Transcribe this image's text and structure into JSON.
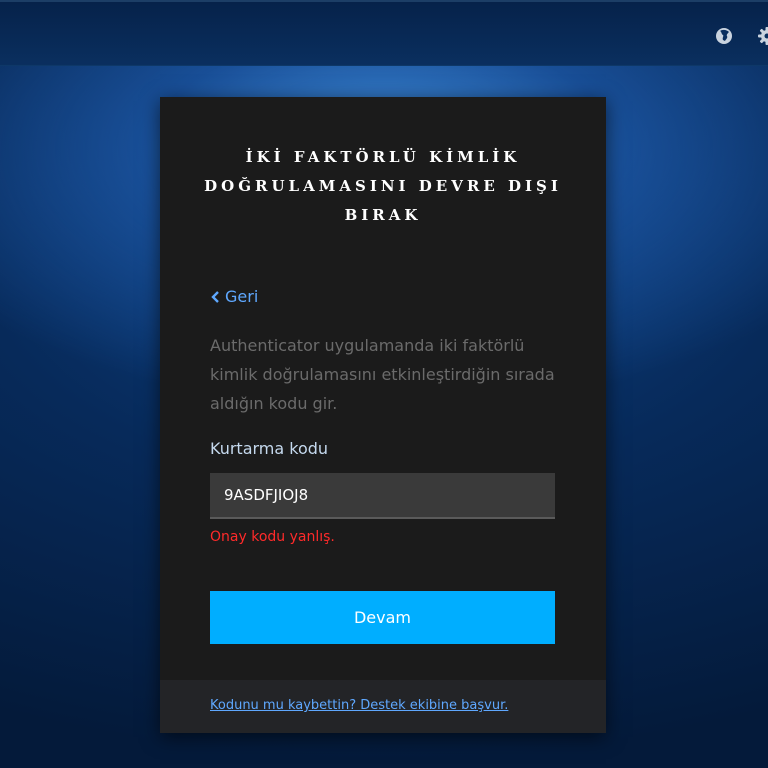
{
  "topbar": {
    "icons": [
      "globe-icon",
      "gear-icon"
    ]
  },
  "card": {
    "title_lines": [
      "İKİ FAKTÖRLÜ KİMLİK",
      "DOĞRULAMASINI DEVRE DIŞI",
      "BIRAK"
    ],
    "back_label": "Geri",
    "description": "Authenticator uygulamanda iki faktörlü kimlik doğrulamasını etkinleştirdiğin sırada aldığın kodu gir.",
    "field_label": "Kurtarma kodu",
    "field_value": "9ASDFJIOJ8",
    "error_text": "Onay kodu yanlış.",
    "submit_label": "Devam",
    "support_link": "Kodunu mu kaybettin? Destek ekibine başvur."
  },
  "colors": {
    "accent": "#00aeff",
    "link": "#5fa8ff",
    "error": "#ff2a2a",
    "card_bg": "#1b1b1b"
  }
}
